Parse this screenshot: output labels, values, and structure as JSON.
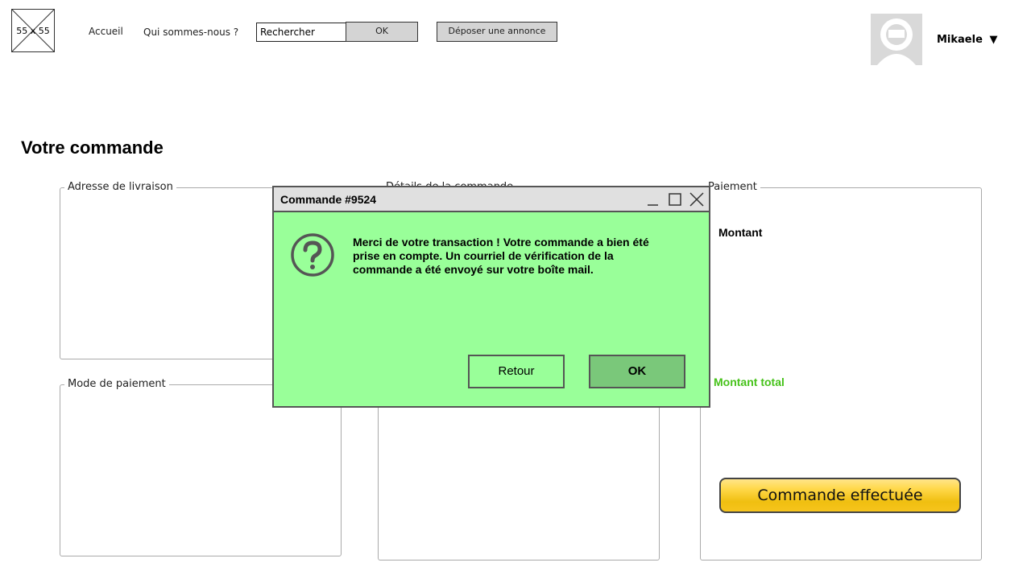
{
  "header": {
    "logo_placeholder": "55 x 55",
    "nav": [
      "Accueil",
      "Qui sommes-nous ?"
    ],
    "search": {
      "value": "Rechercher",
      "button": "OK"
    },
    "post_ad_button": "Déposer une annonce",
    "user": {
      "name": "Mikaele",
      "dropdown_icon": "caret-down-icon"
    }
  },
  "page": {
    "title": "Votre commande",
    "panels": {
      "delivery": "Adresse de livraison",
      "details": "Détails de la commande",
      "payment": "Paiement",
      "payment_mode": "Mode de paiement"
    },
    "payment": {
      "amount_label": "Montant",
      "total_label": "Montant total",
      "total_color": "#46c21a",
      "order_button": "Commande effectuée"
    }
  },
  "dialog": {
    "title": "Commande #9524",
    "icon": "question-circle-icon",
    "message": "Merci de votre transaction ! Votre commande a bien été prise en compte. Un courriel de vérification de la commande a été envoyé sur votre boîte mail.",
    "back_button": "Retour",
    "ok_button": "OK",
    "background": "#99ff99"
  }
}
